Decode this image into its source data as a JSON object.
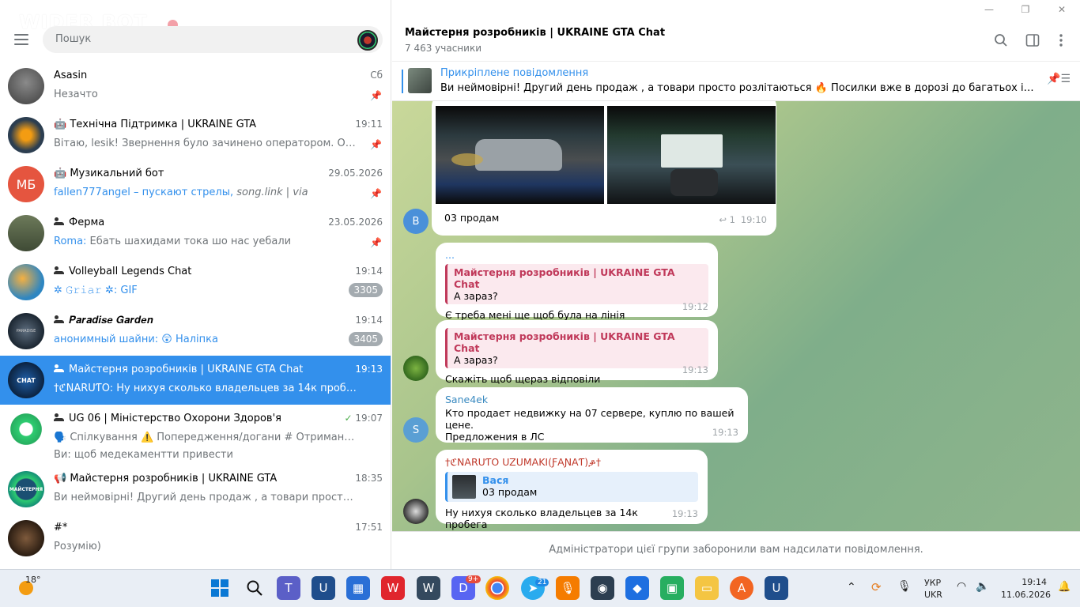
{
  "window_controls": [
    "—",
    "❐",
    "✕"
  ],
  "sidebar": {
    "watermark": "WIDER BOT",
    "search_placeholder": "Пошук",
    "chats": [
      {
        "name": "Asasin",
        "time": "Сб",
        "preview": "Незачто",
        "pinned": true
      },
      {
        "name": "Технічна Підтримка | UKRAINE GTA",
        "time": "19:11",
        "preview": "Вітаю, lesik!  Звернення було зачинено оператором.  Оціні...",
        "pinned": true
      },
      {
        "name": "Музикальний бот",
        "time": "29.05.2026",
        "avatar_text": "МБ",
        "preview_author": "fallen777angel – пускают стрелы,",
        "preview_rest": " song.link | via",
        "pinned": true
      },
      {
        "name": "Ферма",
        "time": "23.05.2026",
        "preview_author": "Roma:",
        "preview_rest": " Ебать шахидами тока шо нас уебали",
        "pinned": true
      },
      {
        "name": "Volleyball Legends Chat",
        "time": "19:14",
        "preview_author": "✲ 𝙶𝚛𝚒𝚊𝚛 ✲:",
        "preview_rest": " GIF",
        "badge": "3305"
      },
      {
        "name": "𝑷𝒂𝒓𝒂𝒅𝒊𝒔𝒆 𝑮𝒂𝒓𝒅𝒆𝒏",
        "time": "19:14",
        "preview_author": "анонимный шайни:",
        "preview_rest": " 😲 Наліпка",
        "badge": "3405"
      },
      {
        "name": "Майстерня розробників | UKRAINE GTA Chat",
        "time": "19:13",
        "preview": "†ℭNARUƬO: Ну нихуя сколько владельцев за 14к пробега"
      },
      {
        "name": "UG 06 | Міністерство Охорони Здоров'я",
        "time": "19:07",
        "preview": "🗣️ Спілкування   ⚠️ Попередження/догани   # Отримання Ролі   ...",
        "preview2": "Ви: щоб медекаментти привести"
      },
      {
        "name": "Майстерня розробників | UKRAINE GTA",
        "time": "18:35",
        "preview": "Ви неймовірні! Другий день продаж , а товари просто розліта..."
      },
      {
        "name": "#*",
        "time": "17:51",
        "preview": "Розумію)"
      }
    ]
  },
  "header": {
    "title": "Майстерня розробників | UKRAINE GTA Chat",
    "subtitle": "7 463 учасники"
  },
  "pinned": {
    "title": "Прикріплене повідомлення",
    "text": "Ви неймовірні! Другий день продаж , а товари просто розлітаються 🔥  Посилки вже в дорозі до багатьох із вас, а ми з..."
  },
  "messages": {
    "m1": {
      "text": "03 продам",
      "replies": "1",
      "time": "19:10",
      "avatar": "В"
    },
    "m2": {
      "sender": "...",
      "reply_name": "Майстерня розробників | UKRAINE GTA Chat",
      "reply_text": "А зараз?",
      "text": "Є треба мені ще щоб була на лінія",
      "time": "19:12"
    },
    "m3": {
      "reply_name": "Майстерня розробників | UKRAINE GTA Chat",
      "reply_text": "А зараз?",
      "text": "Скажіть щоб щераз відповіли",
      "time": "19:13"
    },
    "m4": {
      "sender": "Sane4ek",
      "text1": "Кто продает недвижку на 07 сервере, куплю по вашей цене.",
      "text2": "Предложения в ЛС",
      "time": "19:13",
      "avatar": "S"
    },
    "m5": {
      "sender": "†ℭNARUƬO UZUMAKI(ƑAƝAƬ)ቇ†",
      "reply_name": "Вася",
      "reply_text": "03 продам",
      "text": "Ну нихуя сколько владельцев за 14к пробега",
      "time": "19:13"
    }
  },
  "footer_text": "Адміністратори цієї групи заборонили вам надсилати повідомлення.",
  "taskbar": {
    "weather": "18°",
    "telegram_badge": "21",
    "discord_badge": "9+",
    "lang1": "УКР",
    "lang2": "UKR",
    "clock_time": "19:14",
    "clock_date": "11.06.2026"
  }
}
